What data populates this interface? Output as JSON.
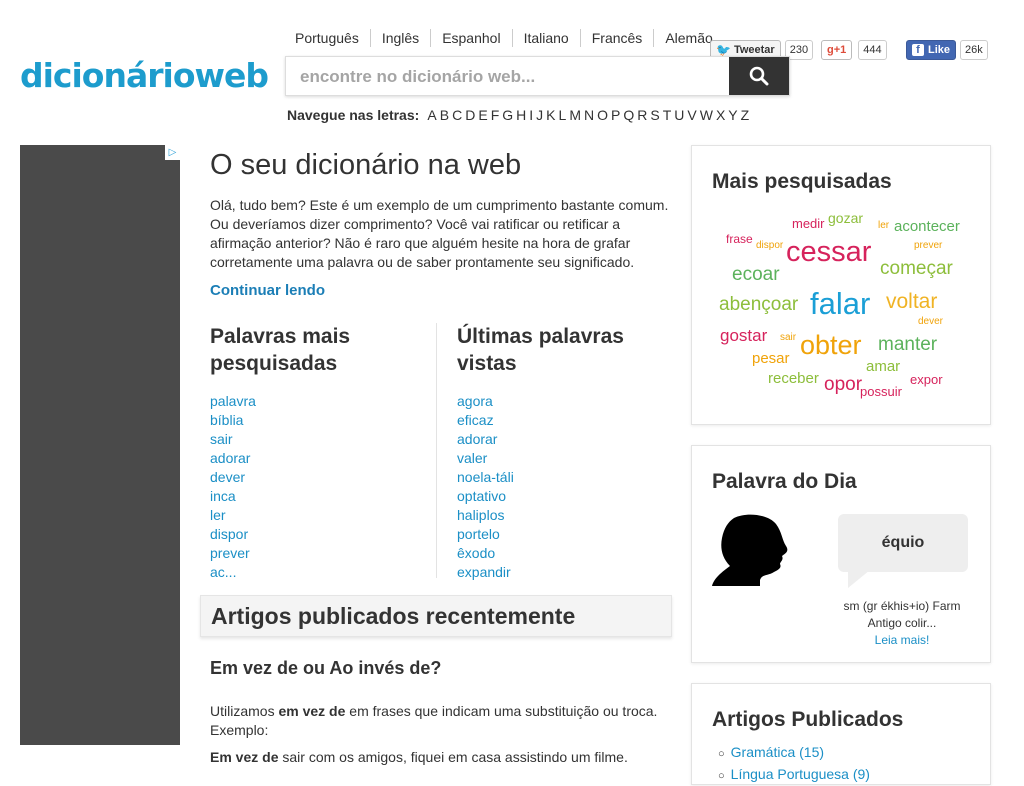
{
  "header": {
    "logo": "dicionárioweb",
    "languages": [
      "Português",
      "Inglês",
      "Espanhol",
      "Italiano",
      "Francês",
      "Alemão"
    ],
    "search_placeholder": "encontre no dicionário web...",
    "letters_label": "Navegue nas letras:",
    "letters": [
      "A",
      "B",
      "C",
      "D",
      "E",
      "F",
      "G",
      "H",
      "I",
      "J",
      "K",
      "L",
      "M",
      "N",
      "O",
      "P",
      "Q",
      "R",
      "S",
      "T",
      "U",
      "V",
      "W",
      "X",
      "Y",
      "Z"
    ]
  },
  "social": {
    "tweet_label": "Tweetar",
    "tweet_count": "230",
    "gplus_label": "+1",
    "gplus_count": "444",
    "fb_label": "Like",
    "fb_count": "26k"
  },
  "main": {
    "title": "O seu dicionário na web",
    "intro": "Olá, tudo bem? Este é um exemplo de um cumprimento bastante comum. Ou deveríamos dizer comprimento? Você vai ratificar ou retificar a afirmação anterior? Não é raro que alguém hesite na hora de grafar corretamente uma palavra ou de saber prontamente seu significado.",
    "continue": "Continuar lendo",
    "most_searched_title": "Palavras mais pesquisadas",
    "most_searched": [
      "palavra",
      "bíblia",
      "sair",
      "adorar",
      "dever",
      "inca",
      "ler",
      "dispor",
      "prever",
      "ac..."
    ],
    "last_seen_title": "Últimas palavras vistas",
    "last_seen": [
      "agora",
      "eficaz",
      "adorar",
      "valer",
      "noela-táli",
      "optativo",
      "haliplos",
      "portelo",
      "êxodo",
      "expandir"
    ],
    "articles_bar": "Artigos publicados recentemente",
    "article_title": "Em vez de ou Ao invés de?",
    "article_p1_pre": "Utilizamos ",
    "article_p1_bold": "em vez de",
    "article_p1_post": " em frases que indicam uma substituição ou troca. Exemplo:",
    "article_p2_bold": "Em vez de",
    "article_p2_post": " sair com os amigos, fiquei em casa assistindo um filme."
  },
  "sidebar": {
    "most_searched_title": "Mais pesquisadas",
    "cloud": [
      {
        "word": "medir",
        "color": "#d6235c"
      },
      {
        "word": "gozar",
        "color": "#8dbe3b"
      },
      {
        "word": "ler",
        "color": "#f0a30a"
      },
      {
        "word": "acontecer",
        "color": "#5bb25b"
      },
      {
        "word": "frase",
        "color": "#d6235c"
      },
      {
        "word": "dispor",
        "color": "#f0a30a"
      },
      {
        "word": "cessar",
        "color": "#d6235c"
      },
      {
        "word": "prever",
        "color": "#f0a30a"
      },
      {
        "word": "ecoar",
        "color": "#5bb25b"
      },
      {
        "word": "começar",
        "color": "#8dbe3b"
      },
      {
        "word": "abençoar",
        "color": "#8dbe3b"
      },
      {
        "word": "falar",
        "color": "#1b9fd6"
      },
      {
        "word": "voltar",
        "color": "#f0b324"
      },
      {
        "word": "dever",
        "color": "#f0a30a"
      },
      {
        "word": "gostar",
        "color": "#d6235c"
      },
      {
        "word": "sair",
        "color": "#f0a30a"
      },
      {
        "word": "obter",
        "color": "#f0a30a"
      },
      {
        "word": "manter",
        "color": "#5bb25b"
      },
      {
        "word": "pesar",
        "color": "#f0a30a"
      },
      {
        "word": "amar",
        "color": "#8dbe3b"
      },
      {
        "word": "receber",
        "color": "#8dbe3b"
      },
      {
        "word": "opor",
        "color": "#d6235c"
      },
      {
        "word": "possuir",
        "color": "#d6235c"
      },
      {
        "word": "expor",
        "color": "#d6235c"
      }
    ],
    "word_of_day_title": "Palavra do Dia",
    "word_of_day": "équio",
    "word_of_day_desc1": "sm (gr ékhis+io) Farm",
    "word_of_day_desc2": "Antigo colir...",
    "word_of_day_more": "Leia mais!",
    "articles_title": "Artigos Publicados",
    "articles": [
      "Gramática (15)",
      "Língua Portuguesa (9)"
    ]
  },
  "colors": {
    "brand": "#1d9ccd",
    "link": "#1b8fc6",
    "ad": "#4a4a4a"
  }
}
